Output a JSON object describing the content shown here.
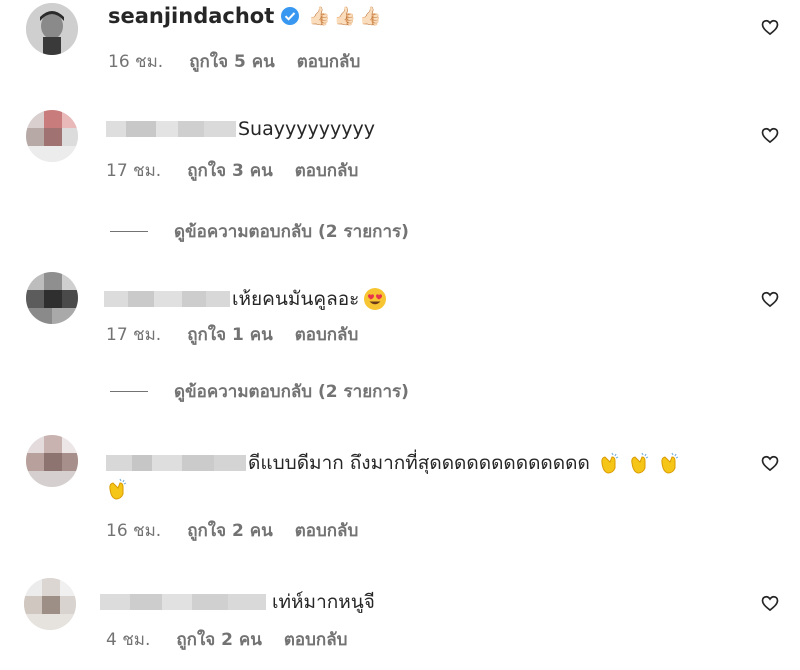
{
  "comments": [
    {
      "username": "seanjindachot",
      "verified": true,
      "text": "",
      "emoji": "👍🏻👍🏻👍🏻",
      "time": "16 ชม.",
      "likes": "ถูกใจ 5 คน",
      "reply": "ตอบกลับ"
    },
    {
      "text": "Suayyyyyyyyy",
      "time": "17 ชม.",
      "likes": "ถูกใจ 3 คน",
      "reply": "ตอบกลับ",
      "view_replies": "ดูข้อความตอบกลับ (2 รายการ)"
    },
    {
      "text": "เห้ยคนมันคูลอะ",
      "emoji": "smiling-face-with-heart-eyes",
      "time": "17 ชม.",
      "likes": "ถูกใจ 1 คน",
      "reply": "ตอบกลับ",
      "view_replies": "ดูข้อความตอบกลับ (2 รายการ)"
    },
    {
      "text": "ดีแบบดีมาก ถึงมากที่สุดดดดดดดดดดดดด",
      "emoji": "clapping-hands x4",
      "time": "16 ชม.",
      "likes": "ถูกใจ 2 คน",
      "reply": "ตอบกลับ"
    },
    {
      "text": "เท่ห์มากหนูจี",
      "time": "4 ชม.",
      "likes": "ถูกใจ 2 คน",
      "reply": "ตอบกลับ"
    }
  ],
  "colors": {
    "text": "#262626",
    "meta": "#737373",
    "verified": "#3897f0",
    "clap": "#f5c518"
  }
}
